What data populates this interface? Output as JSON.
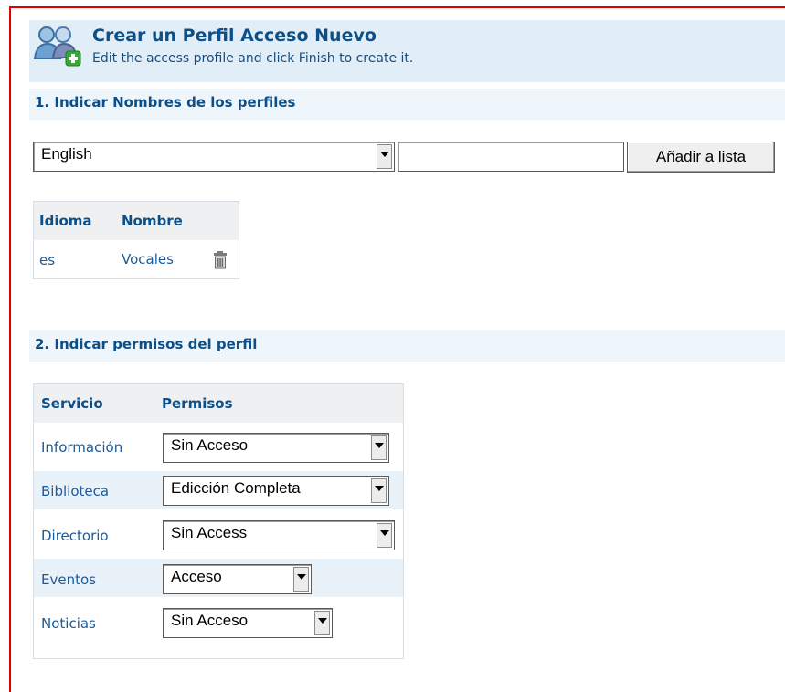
{
  "header": {
    "title": "Crear un Perfil Acceso Nuevo",
    "subtitle": "Edit the access profile and click Finish to create it."
  },
  "section1": {
    "heading": "1. Indicar Nombres de los perfiles",
    "language_select": "English",
    "name_input_value": "",
    "add_button": "Añadir a lista",
    "table": {
      "columns": [
        "Idioma",
        "Nombre"
      ],
      "rows": [
        {
          "idioma": "es",
          "nombre": "Vocales"
        }
      ]
    }
  },
  "section2": {
    "heading": "2. Indicar permisos del perfil",
    "table": {
      "columns": [
        "Servicio",
        "Permisos"
      ],
      "rows": [
        {
          "servicio": "Información",
          "permiso": "Sin Acceso"
        },
        {
          "servicio": "Biblioteca",
          "permiso": "Edicción Completa"
        },
        {
          "servicio": "Directorio",
          "permiso": "Sin Access"
        },
        {
          "servicio": "Eventos",
          "permiso": "Acceso"
        },
        {
          "servicio": "Noticias",
          "permiso": "Sin Acceso"
        }
      ]
    }
  },
  "colors": {
    "border_accent": "#e00000",
    "header_bg": "#e2eef7",
    "title": "#0d4f86",
    "link": "#1c5a99"
  },
  "icons": {
    "header": "users-add-icon",
    "delete": "trash-icon"
  }
}
